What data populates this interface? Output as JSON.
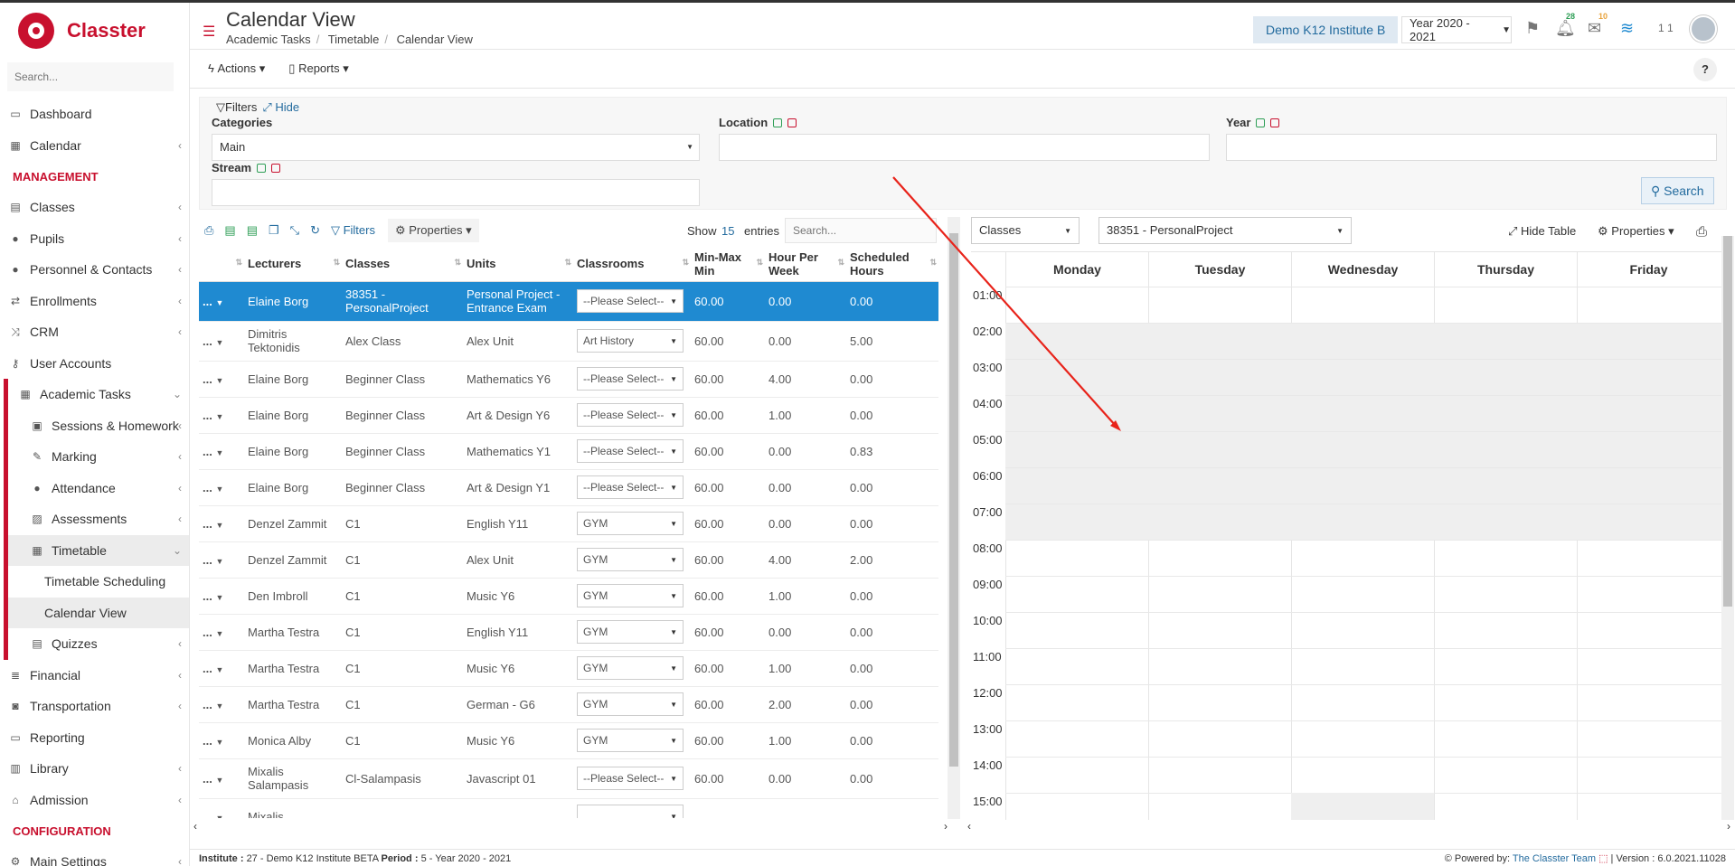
{
  "app": {
    "name": "Classter",
    "search_placeholder": "Search..."
  },
  "header": {
    "title": "Calendar View",
    "breadcrumb": [
      "Academic Tasks",
      "Timetable",
      "Calendar View"
    ],
    "institute": "Demo K12 Institute B",
    "year": "Year 2020 - 2021",
    "notif_count": "28",
    "mail_count": "10",
    "user_count": "1 1"
  },
  "sidebar": {
    "dashboard": "Dashboard",
    "calendar": "Calendar",
    "management": "MANAGEMENT",
    "classes": "Classes",
    "pupils": "Pupils",
    "personnel": "Personnel & Contacts",
    "enrollments": "Enrollments",
    "crm": "CRM",
    "user_accounts": "User Accounts",
    "academic_tasks": "Academic Tasks",
    "sessions": "Sessions & Homework",
    "marking": "Marking",
    "attendance": "Attendance",
    "assessments": "Assessments",
    "timetable": "Timetable",
    "timetable_scheduling": "Timetable Scheduling",
    "calendar_view": "Calendar View",
    "quizzes": "Quizzes",
    "financial": "Financial",
    "transportation": "Transportation",
    "reporting": "Reporting",
    "library": "Library",
    "admission": "Admission",
    "configuration": "CONFIGURATION",
    "main_settings": "Main Settings"
  },
  "toolbar": {
    "actions": "Actions",
    "reports": "Reports",
    "help": "?"
  },
  "filters": {
    "title": "Filters",
    "hide": "Hide",
    "categories_label": "Categories",
    "categories_value": "Main",
    "location_label": "Location",
    "year_label": "Year",
    "stream_label": "Stream",
    "search_btn": "Search"
  },
  "table": {
    "filters_btn": "Filters",
    "properties_btn": "Properties",
    "show": "Show",
    "entries_n": "15",
    "entries": "entries",
    "search_placeholder": "Search...",
    "headers": {
      "lecturers": "Lecturers",
      "classes": "Classes",
      "units": "Units",
      "classrooms": "Classrooms",
      "minmax": "Min-Max Min",
      "hpw": "Hour Per Week",
      "sched": "Scheduled Hours"
    },
    "row_action": "...",
    "rows": [
      {
        "lecturer": "Elaine Borg",
        "class": "38351 - PersonalProject",
        "unit": "Personal Project - Entrance Exam",
        "room": "--Please Select--",
        "minmax": "60.00",
        "hpw": "0.00",
        "sched": "0.00"
      },
      {
        "lecturer": "Dimitris Tektonidis",
        "class": "Alex Class",
        "unit": "Alex Unit",
        "room": "Art History",
        "minmax": "60.00",
        "hpw": "0.00",
        "sched": "5.00"
      },
      {
        "lecturer": "Elaine Borg",
        "class": "Beginner Class",
        "unit": "Mathematics Y6",
        "room": "--Please Select--",
        "minmax": "60.00",
        "hpw": "4.00",
        "sched": "0.00"
      },
      {
        "lecturer": "Elaine Borg",
        "class": "Beginner Class",
        "unit": "Art & Design Y6",
        "room": "--Please Select--",
        "minmax": "60.00",
        "hpw": "1.00",
        "sched": "0.00"
      },
      {
        "lecturer": "Elaine Borg",
        "class": "Beginner Class",
        "unit": "Mathematics Y1",
        "room": "--Please Select--",
        "minmax": "60.00",
        "hpw": "0.00",
        "sched": "0.83"
      },
      {
        "lecturer": "Elaine Borg",
        "class": "Beginner Class",
        "unit": "Art & Design Y1",
        "room": "--Please Select--",
        "minmax": "60.00",
        "hpw": "0.00",
        "sched": "0.00"
      },
      {
        "lecturer": "Denzel Zammit",
        "class": "C1",
        "unit": "English Y11",
        "room": "GYM",
        "minmax": "60.00",
        "hpw": "0.00",
        "sched": "0.00"
      },
      {
        "lecturer": "Denzel Zammit",
        "class": "C1",
        "unit": "Alex Unit",
        "room": "GYM",
        "minmax": "60.00",
        "hpw": "4.00",
        "sched": "2.00"
      },
      {
        "lecturer": "Den Imbroll",
        "class": "C1",
        "unit": "Music Y6",
        "room": "GYM",
        "minmax": "60.00",
        "hpw": "1.00",
        "sched": "0.00"
      },
      {
        "lecturer": "Martha Testra",
        "class": "C1",
        "unit": "English Y11",
        "room": "GYM",
        "minmax": "60.00",
        "hpw": "0.00",
        "sched": "0.00"
      },
      {
        "lecturer": "Martha Testra",
        "class": "C1",
        "unit": "Music Y6",
        "room": "GYM",
        "minmax": "60.00",
        "hpw": "1.00",
        "sched": "0.00"
      },
      {
        "lecturer": "Martha Testra",
        "class": "C1",
        "unit": "German - G6",
        "room": "GYM",
        "minmax": "60.00",
        "hpw": "2.00",
        "sched": "0.00"
      },
      {
        "lecturer": "Monica Alby",
        "class": "C1",
        "unit": "Music Y6",
        "room": "GYM",
        "minmax": "60.00",
        "hpw": "1.00",
        "sched": "0.00"
      },
      {
        "lecturer": "Mixalis Salampasis",
        "class": "Cl-Salampasis",
        "unit": "Javascript 01",
        "room": "--Please Select--",
        "minmax": "60.00",
        "hpw": "0.00",
        "sched": "0.00"
      },
      {
        "lecturer": "Mixalis",
        "class": "",
        "unit": "",
        "room": "",
        "minmax": "",
        "hpw": "",
        "sched": ""
      }
    ]
  },
  "calendar": {
    "type": "Classes",
    "selection": "38351 - PersonalProject",
    "hide_table": "Hide Table",
    "properties": "Properties",
    "days": [
      "Monday",
      "Tuesday",
      "Wednesday",
      "Thursday",
      "Friday"
    ],
    "hours": [
      "01:00",
      "02:00",
      "03:00",
      "04:00",
      "05:00",
      "06:00",
      "07:00",
      "08:00",
      "09:00",
      "10:00",
      "11:00",
      "12:00",
      "13:00",
      "14:00",
      "15:00"
    ]
  },
  "footer": {
    "institute_label": "Institute :",
    "institute": "27 - Demo K12 Institute BETA",
    "period_label": "Period :",
    "period": "5 - Year 2020 - 2021",
    "powered": "Powered by:",
    "team": "The Classter Team",
    "version": "Version : 6.0.2021.11028"
  }
}
